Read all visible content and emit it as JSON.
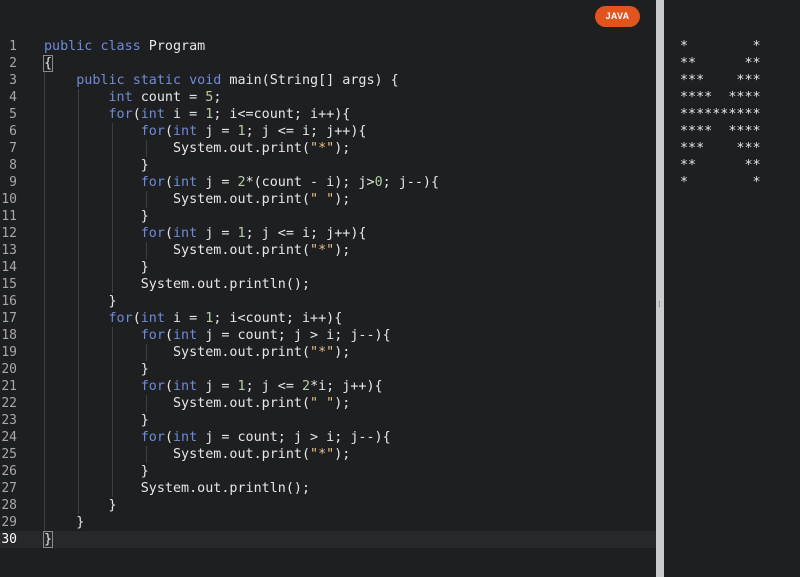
{
  "editor": {
    "language_badge": "JAVA",
    "active_line": 30,
    "lines": [
      "public class Program",
      "{",
      "    public static void main(String[] args) {",
      "        int count = 5;",
      "        for(int i = 1; i<=count; i++){",
      "            for(int j = 1; j <= i; j++){",
      "                System.out.print(\"*\");",
      "            }",
      "            for(int j = 2*(count - i); j>0; j--){",
      "                System.out.print(\" \");",
      "            }",
      "            for(int j = 1; j <= i; j++){",
      "                System.out.print(\"*\");",
      "            }",
      "            System.out.println();",
      "        }",
      "        for(int i = 1; i<count; i++){",
      "            for(int j = count; j > i; j--){",
      "                System.out.print(\"*\");",
      "            }",
      "            for(int j = 1; j <= 2*i; j++){",
      "                System.out.print(\" \");",
      "            }",
      "            for(int j = count; j > i; j--){",
      "                System.out.print(\"*\");",
      "            }",
      "            System.out.println();",
      "        }",
      "    }",
      "}"
    ]
  },
  "output": {
    "lines": [
      "*        *",
      "**      **",
      "***    ***",
      "****  ****",
      "**********",
      "****  ****",
      "***    ***",
      "**      **",
      "*        *"
    ]
  },
  "colors": {
    "keyword": "#6f8bd8",
    "number": "#b5cea8",
    "string": "#e8c08a",
    "badge": "#e2541d",
    "background": "#1e1f21"
  }
}
